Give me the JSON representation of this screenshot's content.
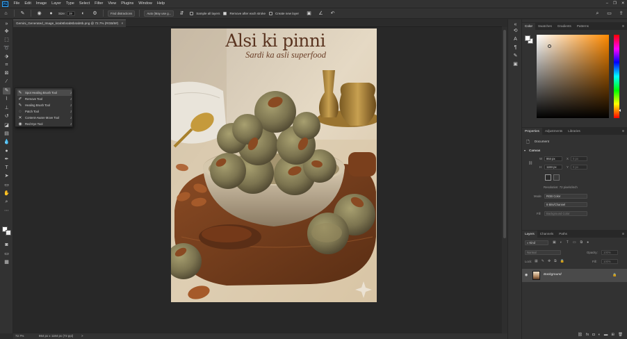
{
  "menubar": {
    "logo": "Ps",
    "items": [
      "File",
      "Edit",
      "Image",
      "Layer",
      "Type",
      "Select",
      "Filter",
      "View",
      "Plugins",
      "Window",
      "Help"
    ],
    "window_controls": [
      "–",
      "❐",
      "✕"
    ]
  },
  "options": {
    "size_label": "Size:",
    "size_value": "19",
    "find_distractions": "Find distractions",
    "mode_value": "Auto (May use g...",
    "sample_all_layers": "Sample all layers",
    "remove_after_stroke": "Remove after each stroke",
    "create_new_layer": "Create new layer"
  },
  "document": {
    "tab_title": "Gemini_Generated_Image_k4ab6b4ab6b4ab6b.png @ 72.7% (RGB/8#)",
    "tab_close": "×"
  },
  "artwork": {
    "title": "Alsi ki pinni",
    "subtitle": "Sardi ka asli superfood"
  },
  "tools_flyout": [
    {
      "label": "Spot Healing Brush Tool",
      "key": "J"
    },
    {
      "label": "Remove Tool",
      "key": "J"
    },
    {
      "label": "Healing Brush Tool",
      "key": "J"
    },
    {
      "label": "Patch Tool",
      "key": "J"
    },
    {
      "label": "Content-Aware Move Tool",
      "key": "J"
    },
    {
      "label": "Red Eye Tool",
      "key": "J"
    }
  ],
  "status": {
    "zoom": "72.7%",
    "dimensions": "864 px x 1184 px (72 ppi)",
    "arrow": ">"
  },
  "color_panel": {
    "tabs": [
      "Color",
      "Swatches",
      "Gradients",
      "Patterns"
    ],
    "active_tab": "Color",
    "hue_color": "#ff8a00"
  },
  "properties_panel": {
    "tabs": [
      "Properties",
      "Adjustments",
      "Libraries"
    ],
    "document_label": "Document",
    "canvas_section": "Canvas",
    "w_label": "W",
    "w_value": "864 px",
    "h_label": "H",
    "h_value": "1184 px",
    "x_label": "X",
    "x_value": "0 px",
    "y_label": "Y",
    "y_value": "0 px",
    "resolution": "Resolution: 72 pixels/inch",
    "mode_label": "Mode",
    "mode_value": "RGB Color",
    "depth_value": "8 Bits/Channel",
    "fill_label": "Fill",
    "fill_value": "Background Color"
  },
  "layers_panel": {
    "tabs": [
      "Layers",
      "Channels",
      "Paths"
    ],
    "kind_filter": "Kind",
    "blend_mode": "Normal",
    "opacity_label": "Opacity:",
    "opacity_value": "100%",
    "lock_label": "Lock:",
    "fill_label": "Fill:",
    "fill_value": "100%",
    "layer_name": "Background"
  }
}
